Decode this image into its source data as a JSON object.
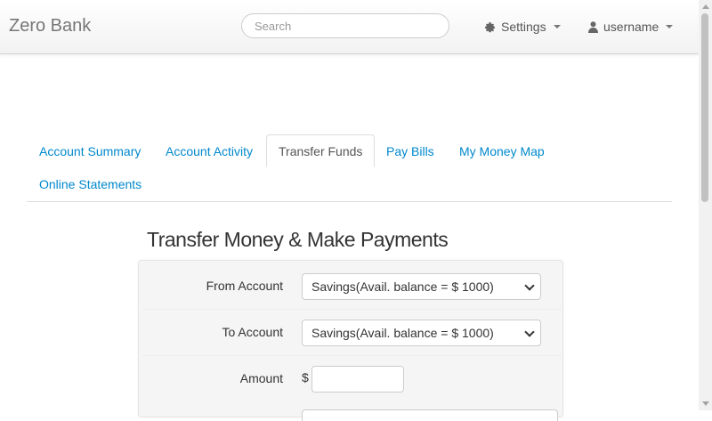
{
  "header": {
    "brand": "Zero Bank",
    "search_placeholder": "Search",
    "settings_label": "Settings",
    "user_label": "username"
  },
  "tabs": [
    {
      "label": "Account Summary",
      "active": false
    },
    {
      "label": "Account Activity",
      "active": false
    },
    {
      "label": "Transfer Funds",
      "active": true
    },
    {
      "label": "Pay Bills",
      "active": false
    },
    {
      "label": "My Money Map",
      "active": false
    },
    {
      "label": "Online Statements",
      "active": false
    }
  ],
  "main": {
    "title": "Transfer Money & Make Payments",
    "form": {
      "from_label": "From Account",
      "from_value": "Savings(Avail. balance = $ 1000)",
      "to_label": "To Account",
      "to_value": "Savings(Avail. balance = $ 1000)",
      "amount_label": "Amount",
      "currency_symbol": "$",
      "amount_value": ""
    }
  },
  "colors": {
    "link": "#0088cc",
    "brand": "#777777",
    "form_background": "#f5f5f5"
  }
}
